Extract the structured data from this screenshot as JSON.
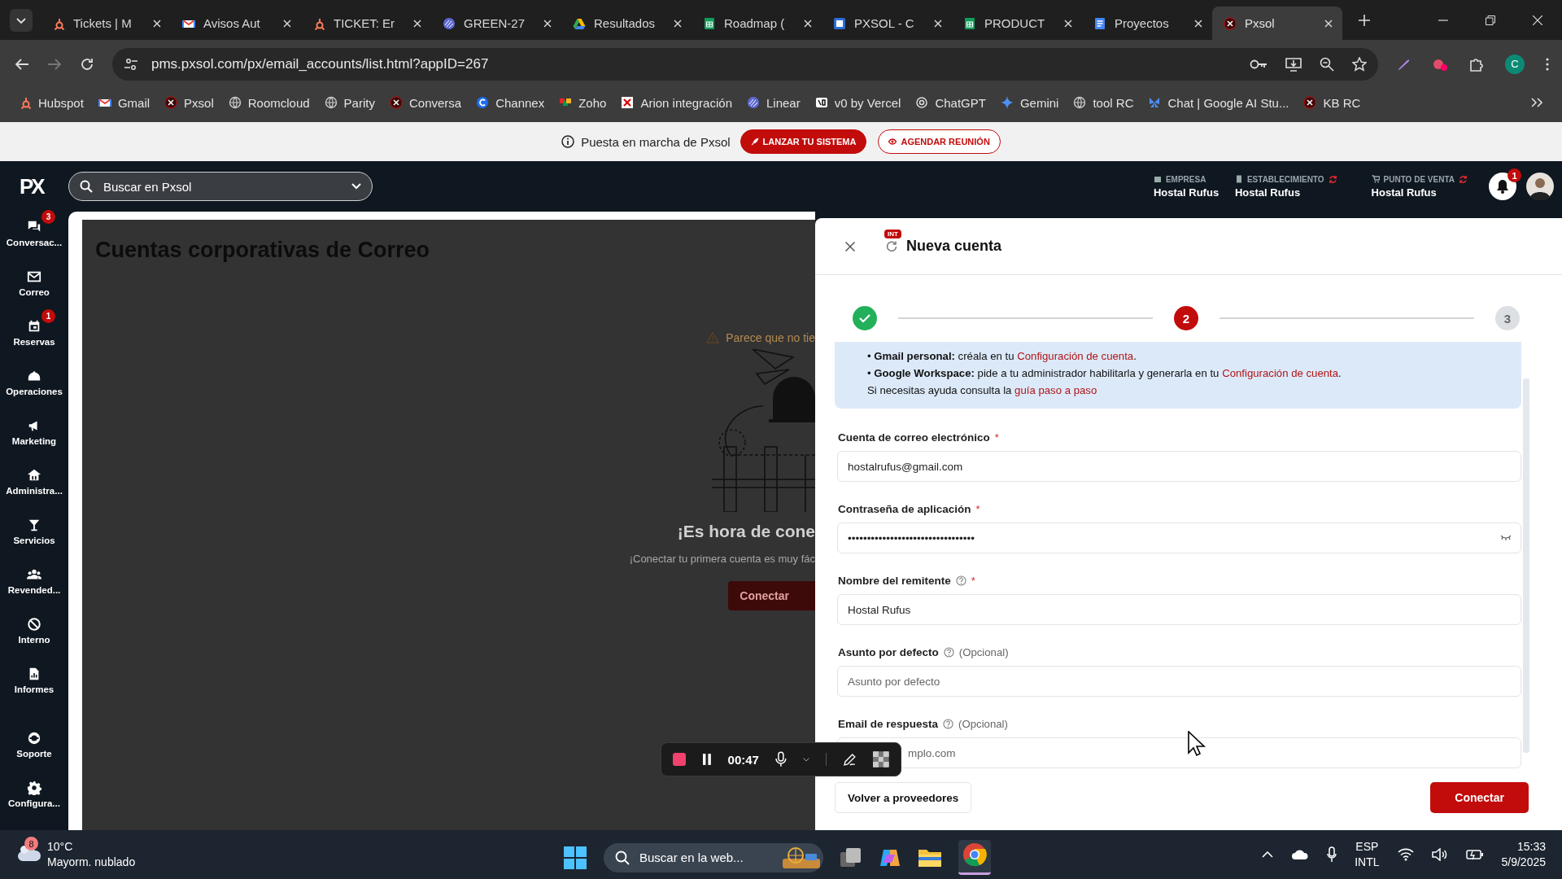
{
  "browser": {
    "tabs": [
      {
        "label": "Tickets | M",
        "selected": false
      },
      {
        "label": "Avisos Aut",
        "selected": false
      },
      {
        "label": "TICKET: Er",
        "selected": false
      },
      {
        "label": "GREEN-27",
        "selected": false
      },
      {
        "label": "Resultados",
        "selected": false
      },
      {
        "label": "Roadmap (",
        "selected": false
      },
      {
        "label": "PXSOL - C",
        "selected": false
      },
      {
        "label": "PRODUCT",
        "selected": false
      },
      {
        "label": "Proyectos",
        "selected": false
      },
      {
        "label": "Pxsol",
        "selected": true
      }
    ],
    "url": "pms.pxsol.com/px/email_accounts/list.html?appID=267",
    "profile": "C",
    "bookmarks": [
      "Hubspot",
      "Gmail",
      "Pxsol",
      "Roomcloud",
      "Parity",
      "Conversa",
      "Channex",
      "Zoho",
      "Arion integración",
      "Linear",
      "v0 by Vercel",
      "ChatGPT",
      "Gemini",
      "tool RC",
      "Chat | Google AI Stu...",
      "KB RC"
    ]
  },
  "banner": {
    "text": "Puesta en marcha de Pxsol",
    "buttons": [
      {
        "label": "LANZAR TU SISTEMA",
        "kind": "primary"
      },
      {
        "label": "AGENDAR REUNIÓN",
        "kind": "outline"
      }
    ]
  },
  "header": {
    "logo": "PX",
    "search_placeholder": "Buscar en Pxsol",
    "contexts": [
      {
        "label": "EMPRESA",
        "value": "Hostal Rufus",
        "sync": false
      },
      {
        "label": "ESTABLECIMIENTO",
        "value": "Hostal Rufus",
        "sync": true
      },
      {
        "label": "PUNTO DE VENTA",
        "value": "Hostal Rufus",
        "sync": true
      }
    ],
    "notifications": "1"
  },
  "sidebar": {
    "items": [
      {
        "label": "Conversac...",
        "badge": "3"
      },
      {
        "label": "Correo"
      },
      {
        "label": "Reservas",
        "badge": "1"
      },
      {
        "label": "Operaciones"
      },
      {
        "label": "Marketing"
      },
      {
        "label": "Administra..."
      },
      {
        "label": "Servicios"
      },
      {
        "label": "Revended..."
      },
      {
        "label": "Interno"
      },
      {
        "label": "Informes"
      }
    ],
    "bottom_items": [
      {
        "label": "Soporte"
      },
      {
        "label": "Configura..."
      }
    ]
  },
  "page": {
    "title": "Cuentas corporativas de Correo",
    "empty_state": {
      "warning": "Parece que no tie",
      "heading": "¡Es hora de cone",
      "text": "¡Conectar tu primera cuenta es muy fác",
      "button": "Conectar"
    }
  },
  "recorder": {
    "time": "00:47"
  },
  "modal": {
    "badge": "INT",
    "title": "Nueva cuenta",
    "steps": [
      {
        "kind": "done"
      },
      {
        "label": "2",
        "kind": "current"
      },
      {
        "label": "3",
        "kind": "pending"
      }
    ],
    "info": [
      {
        "text": "• **Gmail personal:** créala en tu ",
        "link": "Configuración de cuenta",
        "tail": "."
      },
      {
        "text": "• **Google Workspace:** pide a tu administrador habilitarla y generarla en tu ",
        "link": "Configuración de cuenta",
        "tail": "."
      },
      {
        "text": "Si necesitas ayuda consulta la ",
        "link": "guía paso a paso"
      }
    ],
    "fields": [
      {
        "label": "Cuenta de correo electrónico",
        "help": false,
        "required_mark": "*",
        "kind": "text",
        "value": "hostalrufus@gmail.com"
      },
      {
        "label": "Contraseña de aplicación",
        "help": false,
        "required_mark": "*",
        "kind": "password",
        "value": "•••••••••••••••••••••••••••••••••"
      },
      {
        "label": "Nombre del remitente",
        "help": true,
        "required_mark": "*",
        "kind": "text",
        "value": "Hostal Rufus"
      },
      {
        "label": "Asunto por defecto",
        "help": true,
        "note": "(Opcional)",
        "kind": "text",
        "placeholder": "Asunto por defecto"
      },
      {
        "label": "Email de respuesta",
        "help": true,
        "note": "(Opcional)",
        "kind": "text",
        "placeholder": "mplo.com"
      }
    ],
    "back": "Volver a proveedores",
    "submit": "Conectar"
  },
  "taskbar": {
    "weather_badge": "8",
    "temp": "10°C",
    "weather": "Mayorm. nublado",
    "search_placeholder": "Buscar en la web...",
    "lang": "ESP",
    "layout": "INTL",
    "time": "15:33",
    "date": "5/9/2025"
  }
}
